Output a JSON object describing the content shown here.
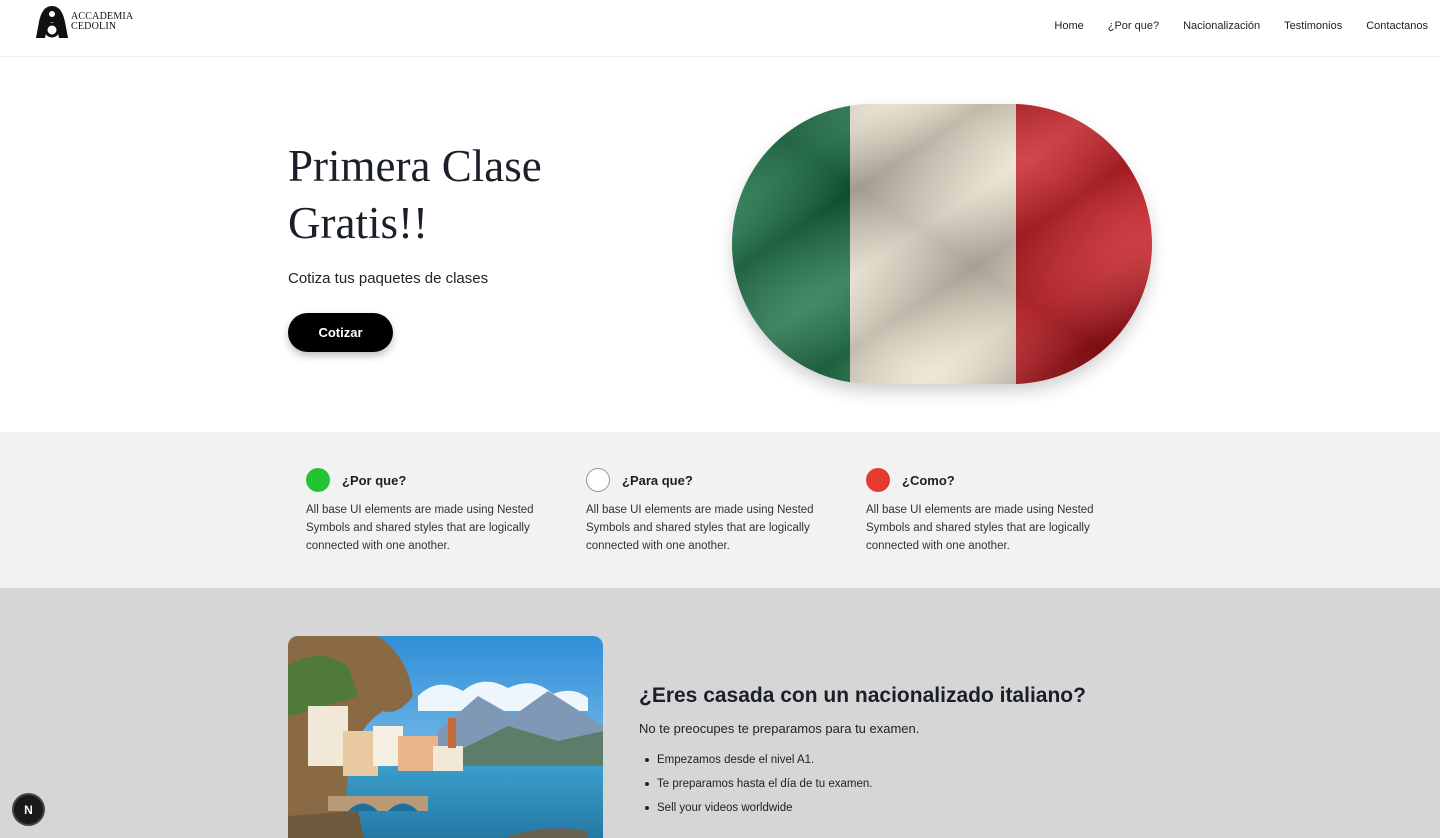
{
  "header": {
    "logo_line1": "ACCADEMIA",
    "logo_line2": "CEDOLIN",
    "nav": [
      {
        "label": "Home"
      },
      {
        "label": "¿Por que?"
      },
      {
        "label": "Nacionalización"
      },
      {
        "label": "Testimonios"
      },
      {
        "label": "Contactanos"
      }
    ]
  },
  "hero": {
    "title": "Primera Clase Gratis!!",
    "subtitle": "Cotiza tus paquetes de clases",
    "cta_label": "Cotizar",
    "flag_colors": [
      "#0f6b3e",
      "#ece3cf",
      "#c4151c"
    ]
  },
  "features": [
    {
      "title": "¿Por que?",
      "text": "All base UI elements are made using Nested Symbols and shared styles that are logically connected with one another.",
      "dot_color": "#22c432"
    },
    {
      "title": "¿Para que?",
      "text": "All base UI elements are made using Nested Symbols and shared styles that are logically connected with one another.",
      "dot_color": "#ffffff"
    },
    {
      "title": "¿Como?",
      "text": "All base UI elements are made using Nested Symbols and shared styles that are logically connected with one another.",
      "dot_color": "#e53a30"
    }
  ],
  "lower": {
    "title": "¿Eres casada con un nacionalizado italiano?",
    "subtitle": "No te preocupes te preparamos para tu examen.",
    "items": [
      "Empezamos desde el nivel A1.",
      "Te preparamos hasta el día de tu examen.",
      "Sell your videos worldwide"
    ]
  },
  "badge": {
    "label": "N"
  }
}
